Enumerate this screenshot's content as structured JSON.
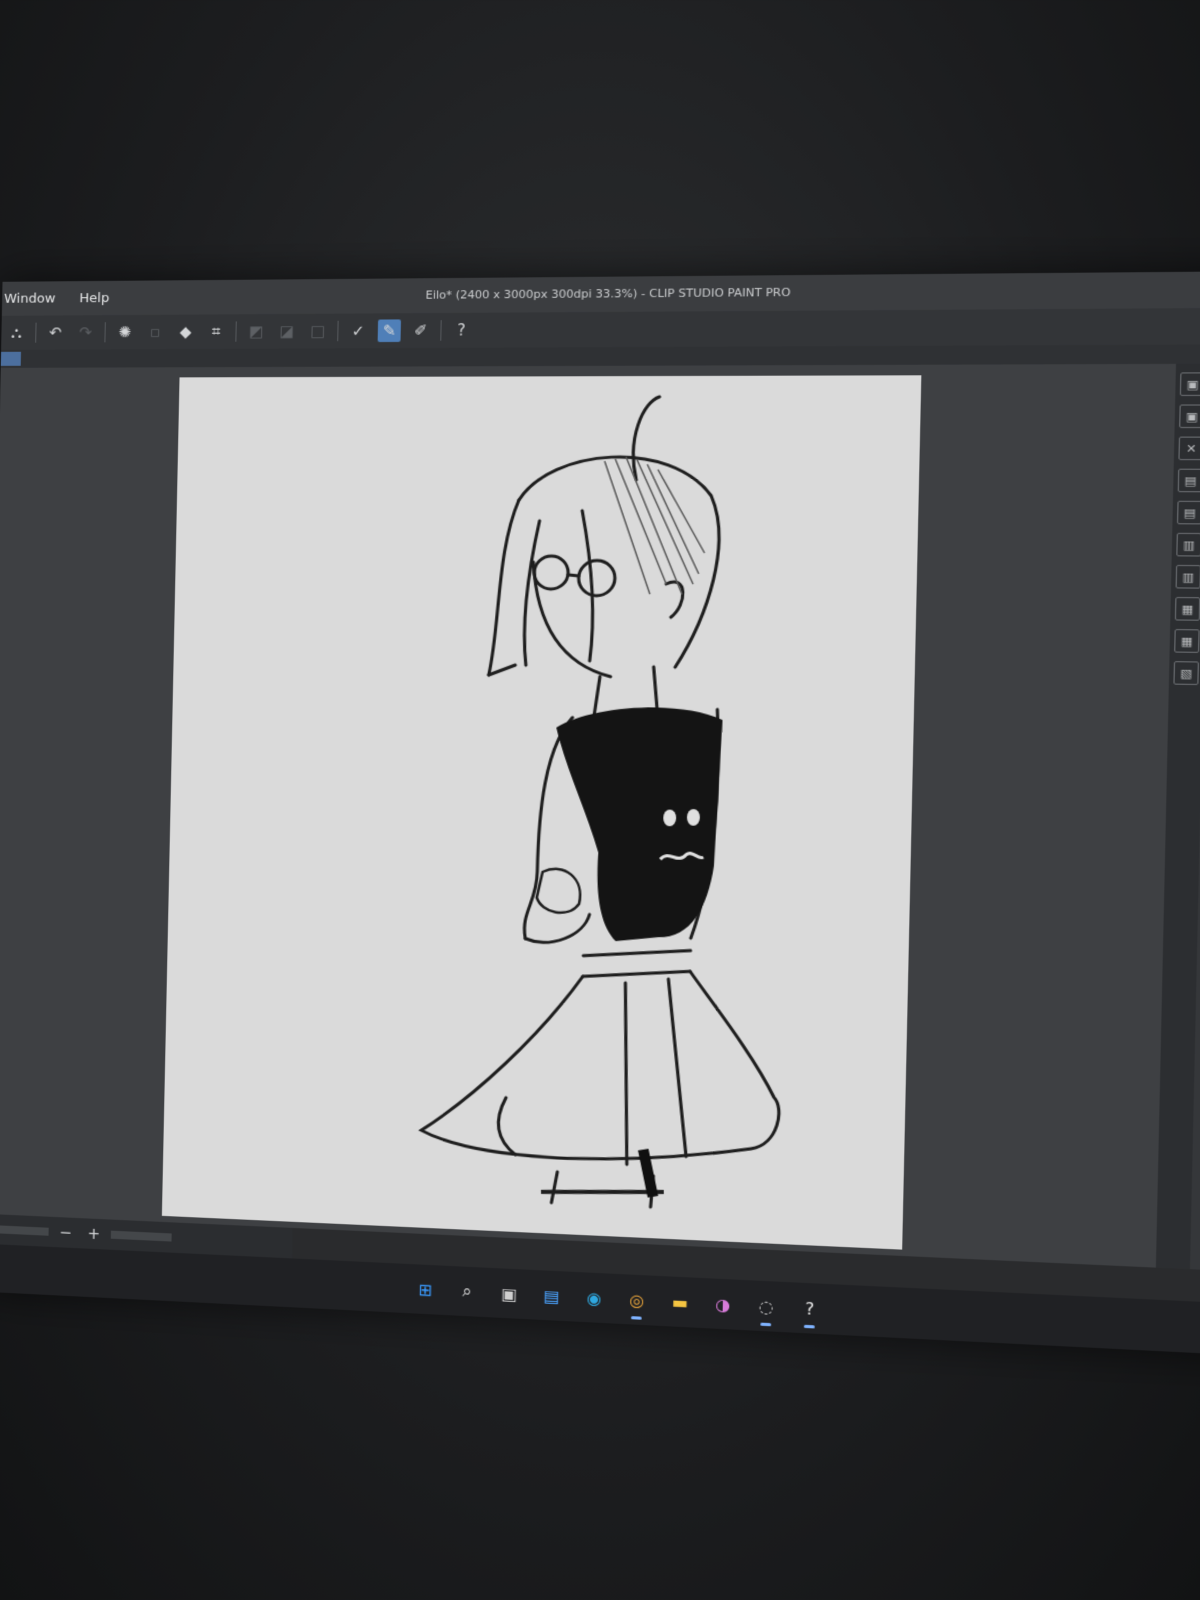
{
  "window": {
    "title": "Eilo* (2400 x 3000px 300dpi 33.3%) - CLIP STUDIO PAINT PRO"
  },
  "menu": {
    "items": [
      "Window",
      "Help"
    ]
  },
  "toolbar": {
    "icons": [
      "export-icon",
      "undo-icon",
      "redo-icon",
      "loading-icon",
      "clear-icon",
      "fill-icon",
      "transform-icon",
      "icon-7",
      "icon-8",
      "icon-9",
      "pen-icon",
      "pen-selected-icon",
      "pen-alt-icon",
      "help-icon"
    ]
  },
  "canvas": {
    "background": "#dadada"
  },
  "taskbar": {
    "apps": [
      {
        "name": "start",
        "glyph": "⊞",
        "color": "#3a9bff"
      },
      {
        "name": "search",
        "glyph": "⌕",
        "color": "#e8e8e8"
      },
      {
        "name": "task-view",
        "glyph": "▣",
        "color": "#cfcfcf"
      },
      {
        "name": "widgets",
        "glyph": "▤",
        "color": "#4aa3ff"
      },
      {
        "name": "edge",
        "glyph": "◉",
        "color": "#2fa8e0"
      },
      {
        "name": "chrome",
        "glyph": "◎",
        "color": "#e5a23b"
      },
      {
        "name": "file-explorer",
        "glyph": "▬",
        "color": "#f5c542"
      },
      {
        "name": "app-8",
        "glyph": "◑",
        "color": "#d77bd9"
      },
      {
        "name": "app-9",
        "glyph": "◌",
        "color": "#c8c8c8"
      },
      {
        "name": "clip-studio",
        "glyph": "?",
        "color": "#e6e6e6"
      }
    ]
  }
}
